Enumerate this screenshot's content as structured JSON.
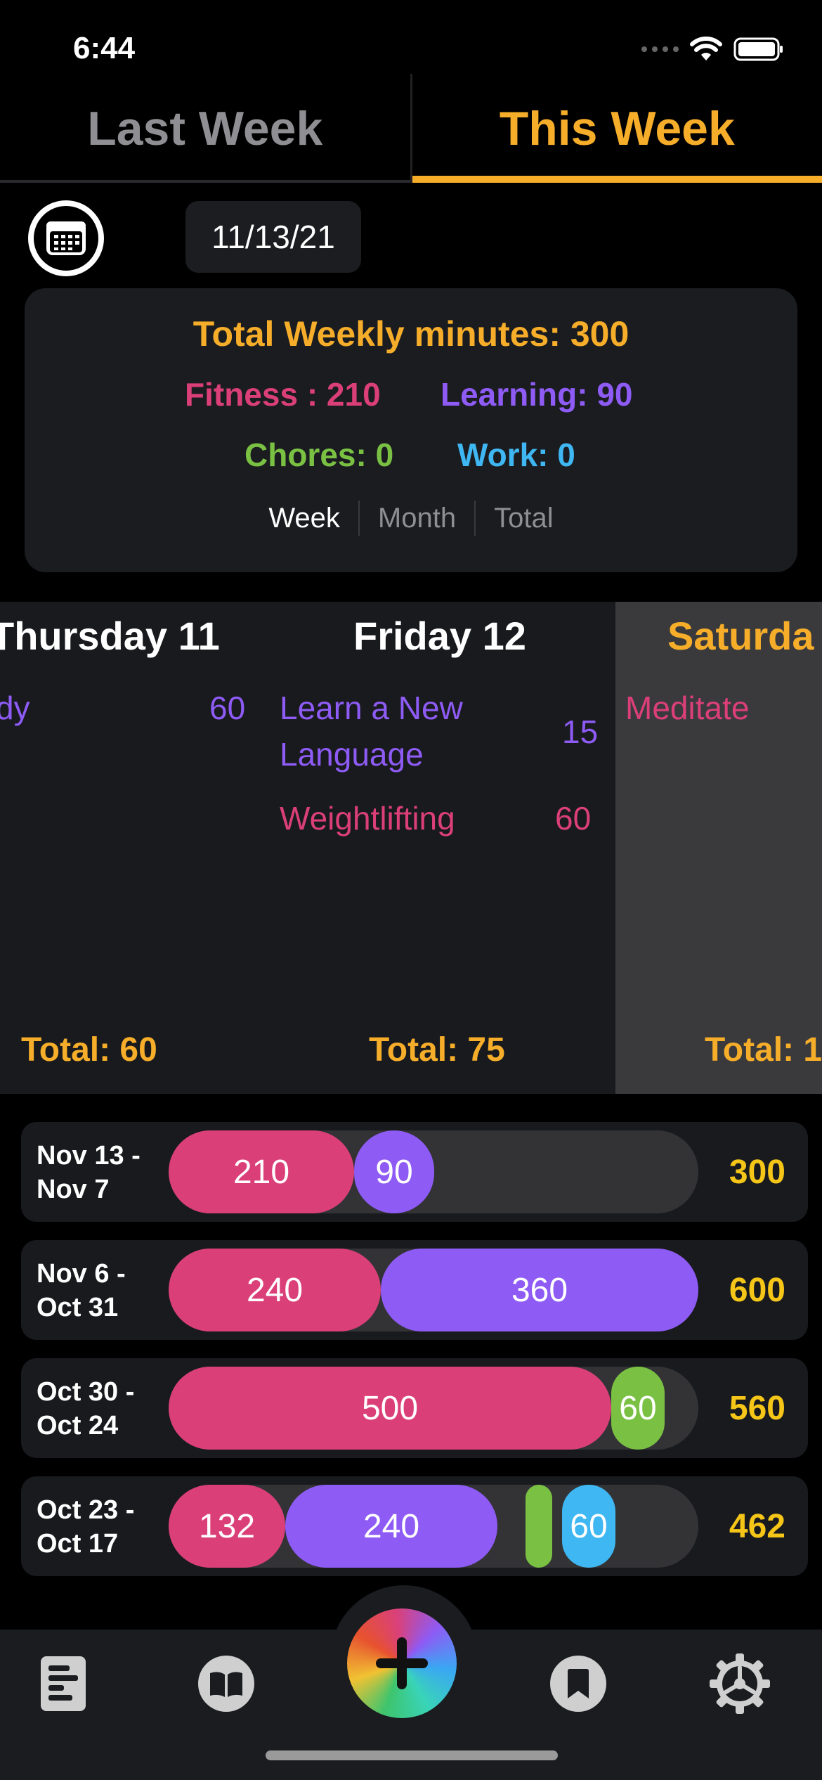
{
  "status_bar": {
    "time": "6:44"
  },
  "tabs": [
    {
      "label": "Last Week"
    },
    {
      "label": "This Week"
    }
  ],
  "date_picker": {
    "value": "11/13/21"
  },
  "summary": {
    "total": "Total Weekly minutes: 300",
    "fitness": "Fitness : 210",
    "learning": "Learning: 90",
    "chores": "Chores: 0",
    "work": "Work: 0",
    "segments": [
      "Week",
      "Month",
      "Total"
    ],
    "selected_segment": "Week"
  },
  "days": {
    "thursday": {
      "title": "Thursday 11",
      "activities": [
        {
          "name": "dy",
          "minutes": "60"
        }
      ],
      "total": "Total: 60"
    },
    "friday": {
      "title": "Friday 12",
      "activities": [
        {
          "name": "Learn a New",
          "name2": "Language",
          "minutes": "15"
        },
        {
          "name": "Weightlifting",
          "minutes": "60"
        }
      ],
      "total": "Total: 75"
    },
    "saturday": {
      "title": "Saturda",
      "activities": [
        {
          "name": "Meditate"
        }
      ],
      "total": "Total: 1"
    }
  },
  "history": [
    {
      "label": "Nov 13 -\nNov 7",
      "total": "300",
      "segments": [
        {
          "category": "fitness",
          "value": "210"
        },
        {
          "category": "learning",
          "value": "90"
        }
      ]
    },
    {
      "label": "Nov 6 -\nOct 31",
      "total": "600",
      "segments": [
        {
          "category": "fitness",
          "value": "240"
        },
        {
          "category": "learning",
          "value": "360"
        }
      ]
    },
    {
      "label": "Oct 30 -\nOct 24",
      "total": "560",
      "segments": [
        {
          "category": "fitness",
          "value": "500"
        },
        {
          "category": "chores",
          "value": "60"
        }
      ]
    },
    {
      "label": "Oct 23 -\nOct 17",
      "total": "462",
      "segments": [
        {
          "category": "fitness",
          "value": "132"
        },
        {
          "category": "learning",
          "value": "240"
        },
        {
          "category": "chores",
          "value": ""
        },
        {
          "category": "work",
          "value": "60"
        }
      ]
    }
  ],
  "colors": {
    "accent": "#f5ad2a",
    "fitness": "#db3f78",
    "learning": "#8e5bf5",
    "chores": "#7ac143",
    "work": "#3fb7f2",
    "total_yellow": "#f5c518"
  },
  "tab_bar": {
    "icons": [
      "document-list-icon",
      "book-icon",
      "plus-icon",
      "bookmark-icon",
      "settings-icon"
    ]
  }
}
